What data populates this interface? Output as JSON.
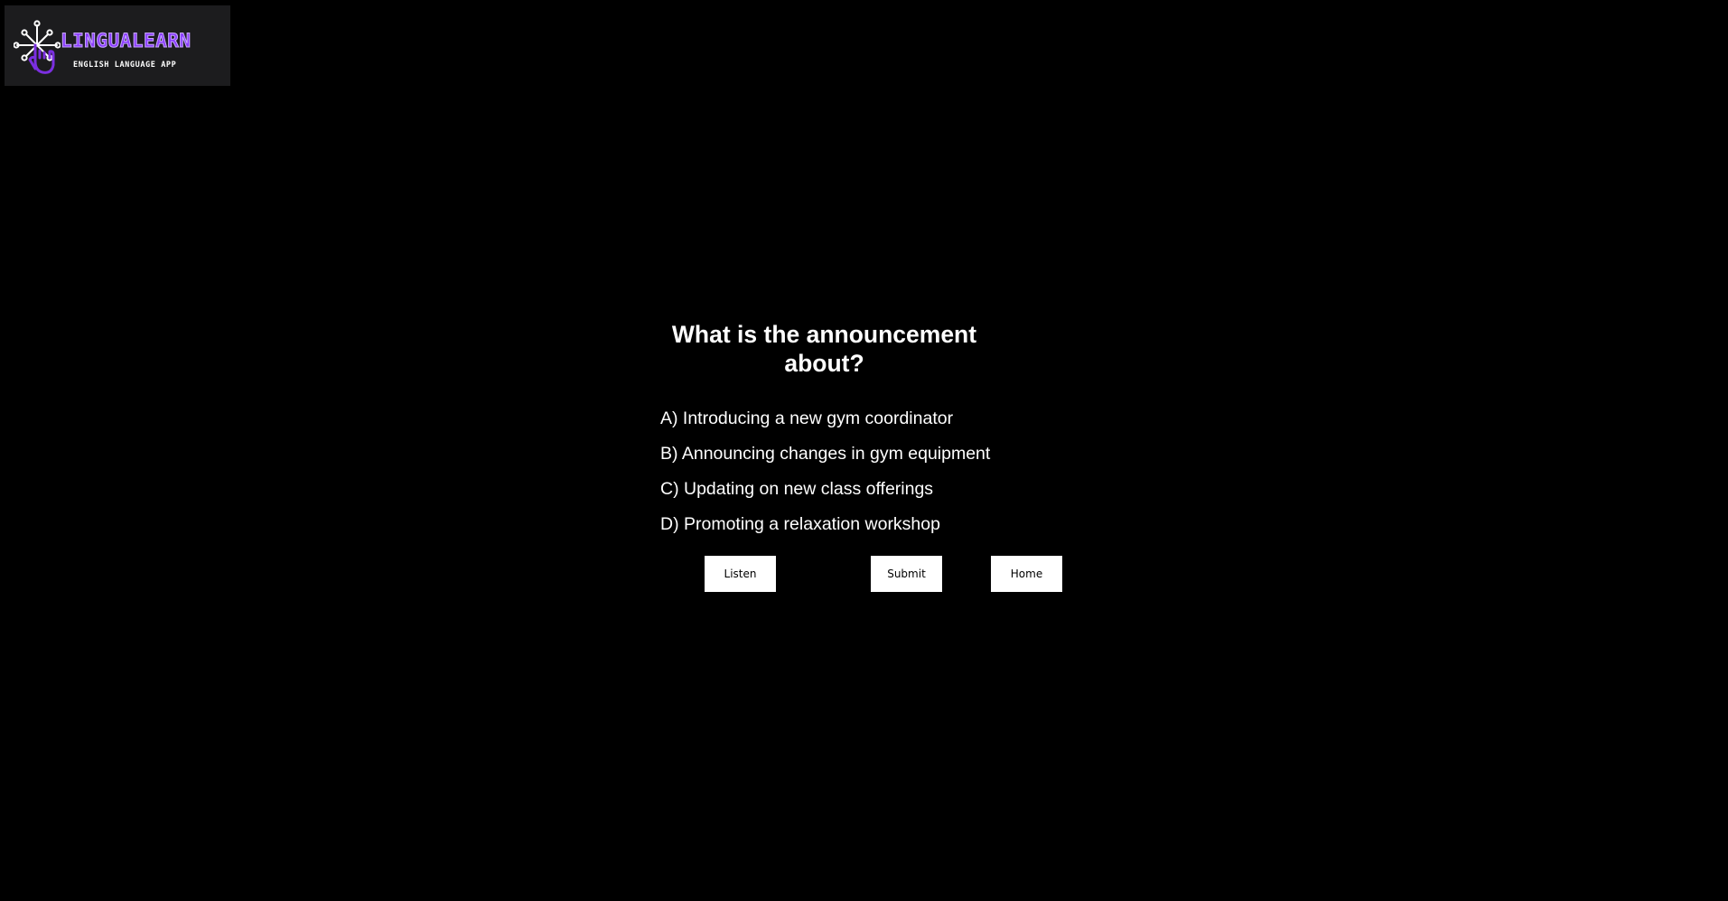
{
  "logo": {
    "brand": "LINGUALEARN",
    "tagline": "ENGLISH LANGUAGE APP",
    "icon": "circuit-hand-icon",
    "colors": {
      "brand": "#8b3dff",
      "background": "#1c1c1e"
    }
  },
  "quiz": {
    "question": "What is the announcement about?",
    "options": [
      "A) Introducing a new gym coordinator",
      "B) Announcing changes in gym equipment",
      "C) Updating on new class offerings",
      "D) Promoting a relaxation workshop"
    ]
  },
  "buttons": {
    "listen": "Listen",
    "submit": "Submit",
    "home": "Home"
  },
  "colors": {
    "background": "#000000",
    "text": "#ffffff",
    "button_bg": "#ffffff",
    "button_text": "#000000"
  }
}
